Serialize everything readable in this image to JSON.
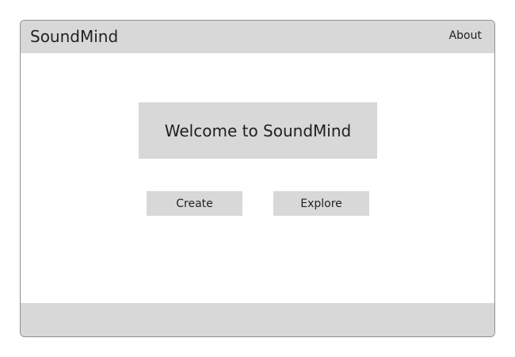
{
  "app": {
    "title": "SoundMind"
  },
  "header": {
    "nav": {
      "about_label": "About"
    }
  },
  "main": {
    "welcome_text": "Welcome to SoundMind",
    "buttons": {
      "create_label": "Create",
      "explore_label": "Explore"
    }
  },
  "colors": {
    "panel_gray": "#d8d8d8",
    "text": "#1f1f1f",
    "border": "#8f8f8f",
    "background": "#ffffff"
  }
}
